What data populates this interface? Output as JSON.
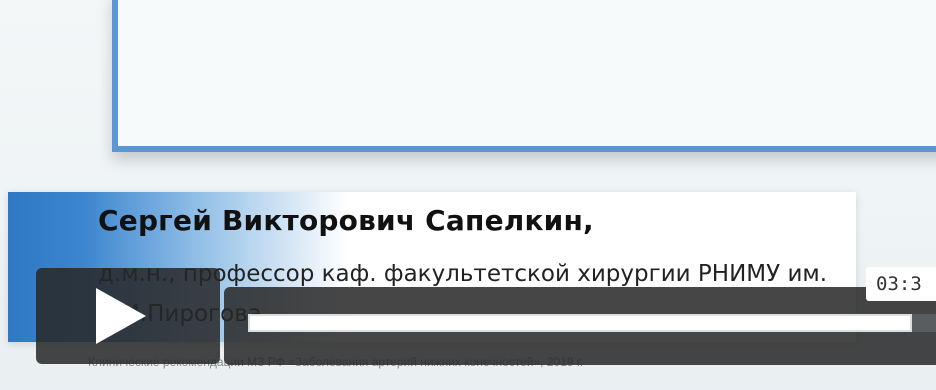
{
  "slide": {
    "speaker_name": "Сергей Викторович Сапелкин,",
    "speaker_title": "д.м.н., профессор каф. факультетской хирургии РНИМУ им. Н.И.Пирогова",
    "footnote": "Клинические рекомендации МЗ РФ «Заболевания артерий нижних конечностей», 2019 г."
  },
  "player": {
    "play_icon": "play-icon",
    "hover_time": "03:3",
    "progress_fraction": 0.965,
    "colors": {
      "overlay": "#282828",
      "accent_frame": "#5b97d6",
      "band_blue": "#2f78c4"
    }
  }
}
